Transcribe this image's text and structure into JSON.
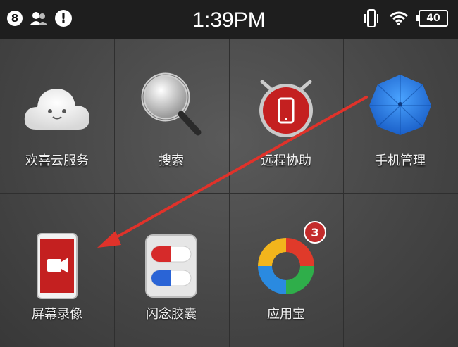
{
  "status_bar": {
    "notification_count": "8",
    "time": "1:39PM",
    "battery_level": "40"
  },
  "apps": [
    {
      "label": "欢喜云服务",
      "icon": "cloud-icon"
    },
    {
      "label": "搜索",
      "icon": "magnifier-icon"
    },
    {
      "label": "远程协助",
      "icon": "phone-alarm-icon"
    },
    {
      "label": "手机管理",
      "icon": "umbrella-icon"
    },
    {
      "label": "屏幕录像",
      "icon": "video-recorder-icon"
    },
    {
      "label": "闪念胶囊",
      "icon": "capsule-icon"
    },
    {
      "label": "应用宝",
      "icon": "app-store-icon",
      "badge": "3"
    }
  ],
  "colors": {
    "arrow": "#e0322a",
    "badge": "#c42b2b"
  }
}
